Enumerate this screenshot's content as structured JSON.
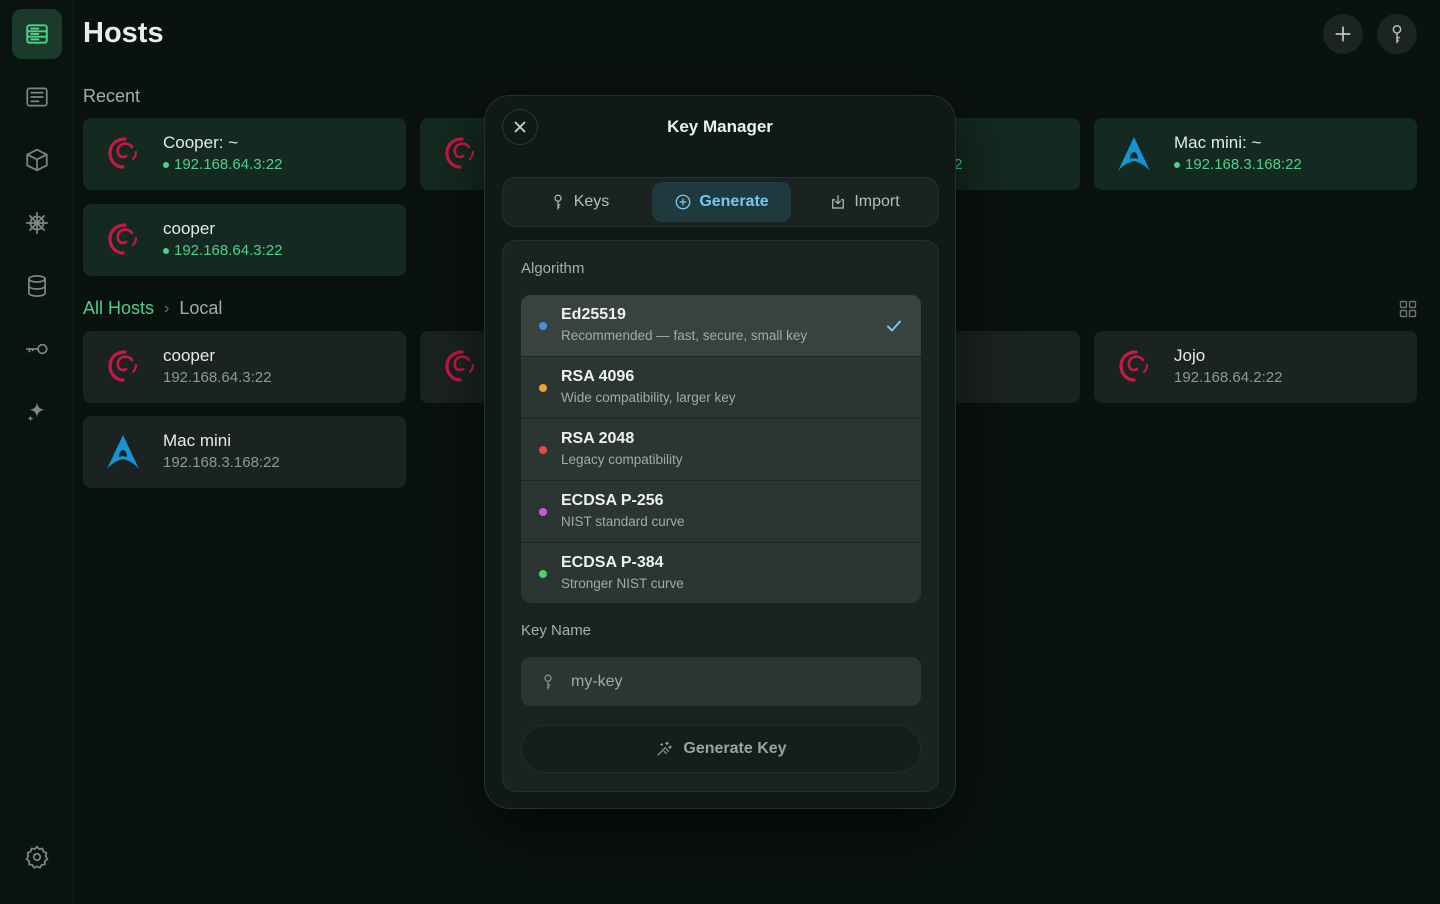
{
  "header": {
    "title": "Hosts"
  },
  "sidebar": {
    "items": [
      {
        "icon": "server-rack-icon",
        "active": true
      },
      {
        "icon": "terminal-list-icon"
      },
      {
        "icon": "cube-icon"
      },
      {
        "icon": "helm-icon"
      },
      {
        "icon": "database-icon"
      },
      {
        "icon": "key-icon"
      },
      {
        "icon": "sparkle-icon"
      },
      {
        "icon": "gear-icon"
      }
    ]
  },
  "sections": {
    "recent": "Recent",
    "breadcrumb_root": "All Hosts",
    "breadcrumb_leaf": "Local"
  },
  "recent_hosts": [
    {
      "name": "Cooper: ~",
      "address": "192.168.64.3:22",
      "os": "debian"
    },
    {
      "name": "",
      "address": "",
      "os": "debian"
    },
    {
      "name": "",
      "address": "2",
      "os": ""
    },
    {
      "name": "Mac mini: ~",
      "address": "192.168.3.168:22",
      "os": "arch"
    },
    {
      "name": "cooper",
      "address": "192.168.64.3:22",
      "os": "debian"
    }
  ],
  "local_hosts": [
    {
      "name": "cooper",
      "address": "192.168.64.3:22",
      "os": "debian"
    },
    {
      "name": "",
      "address": "",
      "os": "debian"
    },
    {
      "name": "Jojo",
      "address": "192.168.64.2:22",
      "os": "debian"
    },
    {
      "name": "Mac mini",
      "address": "192.168.3.168:22",
      "os": "arch"
    }
  ],
  "modal": {
    "title": "Key Manager",
    "tabs": [
      {
        "label": "Keys",
        "icon": "key-icon"
      },
      {
        "label": "Generate",
        "icon": "plus-circle-icon",
        "active": true
      },
      {
        "label": "Import",
        "icon": "import-icon"
      }
    ],
    "algorithm_label": "Algorithm",
    "algorithms": [
      {
        "name": "Ed25519",
        "desc": "Recommended — fast, secure, small key",
        "color": "#4a90e2",
        "selected": true
      },
      {
        "name": "RSA 4096",
        "desc": "Wide compatibility, larger key",
        "color": "#f0a030"
      },
      {
        "name": "RSA 2048",
        "desc": "Legacy compatibility",
        "color": "#e84a4a"
      },
      {
        "name": "ECDSA P-256",
        "desc": "NIST standard curve",
        "color": "#c65ad8"
      },
      {
        "name": "ECDSA P-384",
        "desc": "Stronger NIST curve",
        "color": "#4fd06a"
      }
    ],
    "key_name_label": "Key Name",
    "key_name_placeholder": "my-key",
    "generate_button": "Generate Key"
  },
  "colors": {
    "accent_green": "#4fd08b",
    "accent_blue": "#79c6ef",
    "debian_red": "#c8174b",
    "arch_blue": "#1793d1"
  }
}
